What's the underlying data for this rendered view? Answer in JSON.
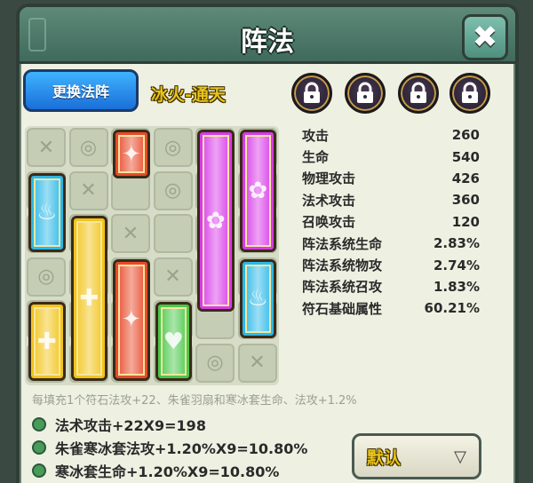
{
  "header": {
    "title": "阵法",
    "close_symbol": "✖"
  },
  "toolbar": {
    "swap_label": "更换法阵",
    "array_name": "冰火-通天"
  },
  "locks": [
    "lock-icon",
    "lock-icon",
    "lock-icon",
    "lock-icon"
  ],
  "stats": [
    {
      "label": "攻击",
      "value": "260"
    },
    {
      "label": "生命",
      "value": "540"
    },
    {
      "label": "物理攻击",
      "value": "426"
    },
    {
      "label": "法术攻击",
      "value": "360"
    },
    {
      "label": "召唤攻击",
      "value": "120"
    },
    {
      "label": "阵法系统生命",
      "value": "2.83%"
    },
    {
      "label": "阵法系统物攻",
      "value": "2.74%"
    },
    {
      "label": "阵法系统召攻",
      "value": "1.83%"
    },
    {
      "label": "符石基础属性",
      "value": "60.21%"
    }
  ],
  "info": "每填充1个符石法攻+22、朱雀羽扇和寒冰套生命、法攻+1.2%",
  "bonuses": [
    "法术攻击+22X9=198",
    "朱雀寒冰套法攻+1.20%X9=10.80%",
    "寒冰套生命+1.20%X9=10.80%"
  ],
  "dropdown": {
    "label": "默认",
    "arrow": "▽"
  },
  "board": {
    "cells": [
      "✕",
      "◎",
      "",
      "◎",
      "",
      "",
      "",
      "✕",
      "",
      "◎",
      "",
      "",
      "",
      "",
      "✕",
      "",
      "",
      "",
      "◎",
      "",
      "",
      "✕",
      "",
      "",
      "",
      "",
      "",
      "",
      "",
      "✕",
      "",
      "",
      "",
      "",
      "◎",
      "✕"
    ],
    "pieces": [
      {
        "name": "red-fire-stone",
        "icon": "✦",
        "color": "#e84a2a"
      },
      {
        "name": "blue-ice-stone",
        "icon": "♨",
        "color": "#2ab8e8"
      },
      {
        "name": "yellow-long-stone",
        "icon": "✚",
        "color": "#f2c41a"
      },
      {
        "name": "red-long-stone",
        "icon": "✦",
        "color": "#e84a2a"
      },
      {
        "name": "magenta-tall-stone",
        "icon": "✿",
        "color": "#d83ae8"
      },
      {
        "name": "magenta-paw-stone",
        "icon": "✿",
        "color": "#d83ae8"
      },
      {
        "name": "blue-ice-stone-2",
        "icon": "♨",
        "color": "#2ab8e8"
      },
      {
        "name": "yellow-short-stone",
        "icon": "✚",
        "color": "#f2c41a"
      },
      {
        "name": "green-heart-stone",
        "icon": "♥",
        "color": "#4ac84a"
      }
    ]
  }
}
